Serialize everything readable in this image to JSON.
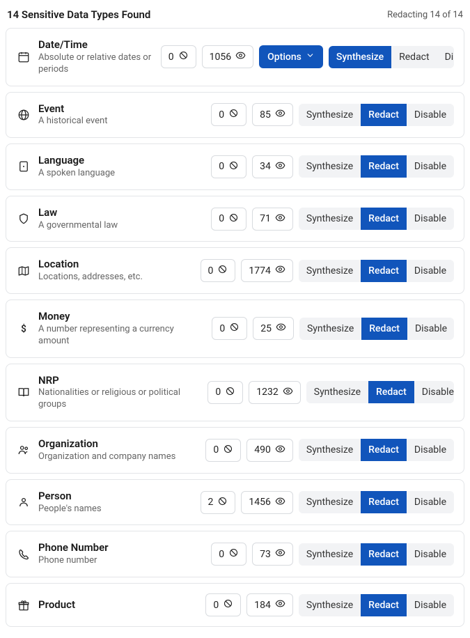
{
  "header": {
    "title": "14 Sensitive Data Types Found",
    "status": "Redacting 14 of 14"
  },
  "labels": {
    "options": "Options",
    "synthesize": "Synthesize",
    "redact": "Redact",
    "disable": "Disable"
  },
  "items": [
    {
      "icon": "calendar",
      "title": "Date/Time",
      "desc": "Absolute or relative dates or periods",
      "blocked": 0,
      "visible": 1056,
      "active": "synthesize",
      "showOptions": true
    },
    {
      "icon": "globe",
      "title": "Event",
      "desc": "A historical event",
      "blocked": 0,
      "visible": 85,
      "active": "redact",
      "showOptions": false
    },
    {
      "icon": "language",
      "title": "Language",
      "desc": "A spoken language",
      "blocked": 0,
      "visible": 34,
      "active": "redact",
      "showOptions": false
    },
    {
      "icon": "shield",
      "title": "Law",
      "desc": "A governmental law",
      "blocked": 0,
      "visible": 71,
      "active": "redact",
      "showOptions": false
    },
    {
      "icon": "map",
      "title": "Location",
      "desc": "Locations, addresses, etc.",
      "blocked": 0,
      "visible": 1774,
      "active": "redact",
      "showOptions": false
    },
    {
      "icon": "dollar",
      "title": "Money",
      "desc": "A number representing a currency amount",
      "blocked": 0,
      "visible": 25,
      "active": "redact",
      "showOptions": false
    },
    {
      "icon": "book",
      "title": "NRP",
      "desc": "Nationalities or religious or political groups",
      "blocked": 0,
      "visible": 1232,
      "active": "redact",
      "showOptions": false
    },
    {
      "icon": "org",
      "title": "Organization",
      "desc": "Organization and company names",
      "blocked": 0,
      "visible": 490,
      "active": "redact",
      "showOptions": false
    },
    {
      "icon": "person",
      "title": "Person",
      "desc": "People's names",
      "blocked": 2,
      "visible": 1456,
      "active": "redact",
      "showOptions": false
    },
    {
      "icon": "phone",
      "title": "Phone Number",
      "desc": "Phone number",
      "blocked": 0,
      "visible": 73,
      "active": "redact",
      "showOptions": false
    },
    {
      "icon": "gift",
      "title": "Product",
      "desc": "",
      "blocked": 0,
      "visible": 184,
      "active": "redact",
      "showOptions": false
    }
  ]
}
